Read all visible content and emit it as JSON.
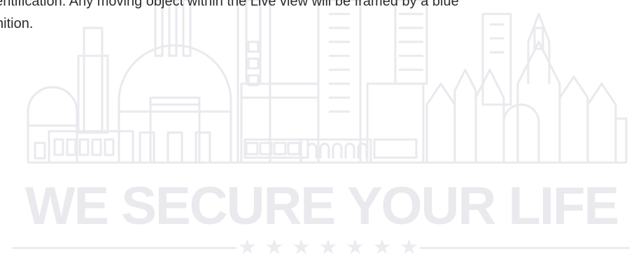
{
  "intro": {
    "line1": "dentification. Any moving object within the Live view will be framed by a blue",
    "line2": "nition."
  },
  "watermark": {
    "tagline": "WE SECURE YOUR LIFE",
    "star_glyph": "★",
    "star_count": 7,
    "color": "#e9e9ee"
  },
  "colors": {
    "text": "#2c2c2c",
    "watermark": "#e9e9ee",
    "background": "#ffffff"
  }
}
